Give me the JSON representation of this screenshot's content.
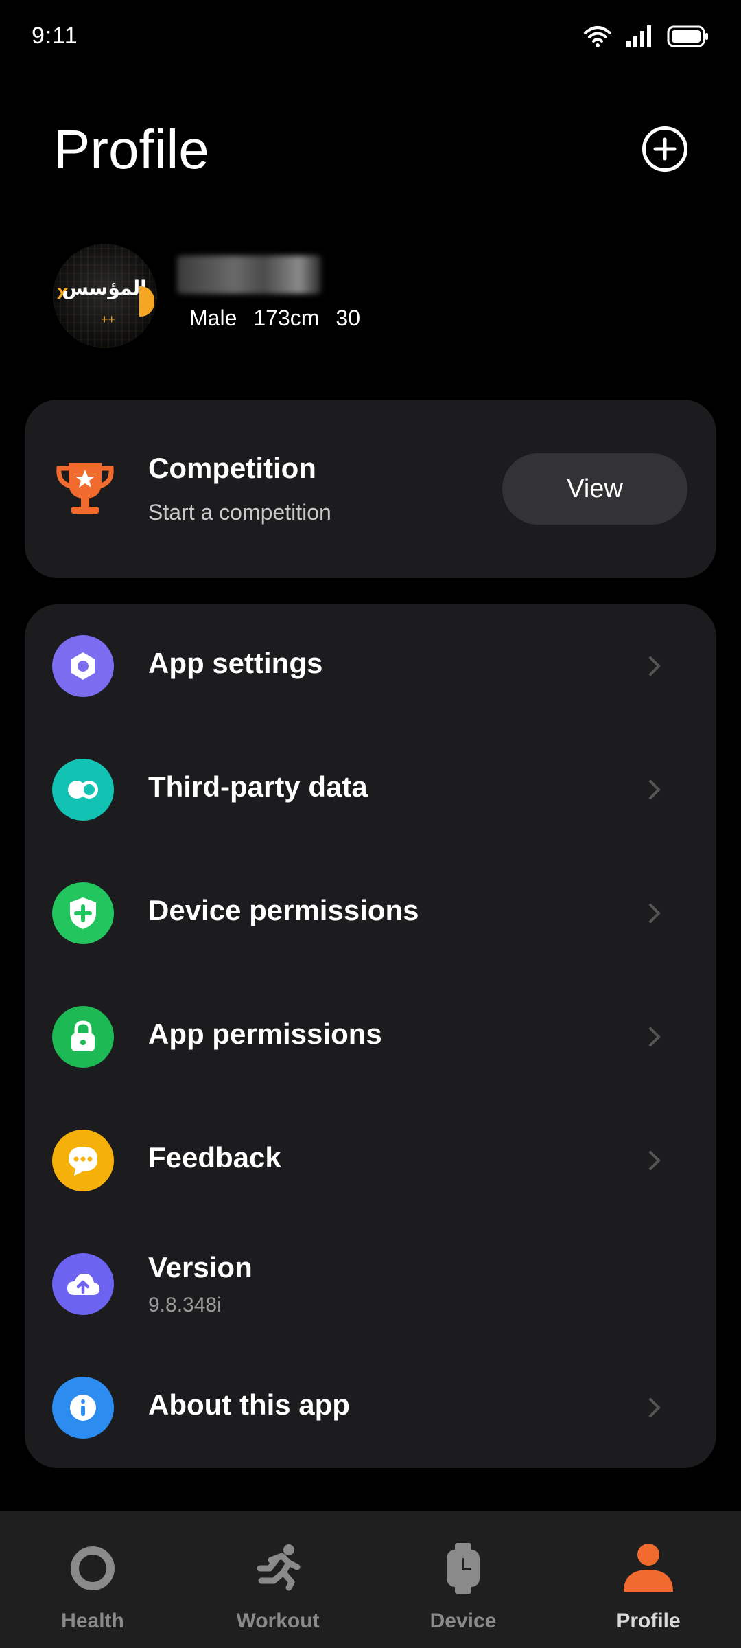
{
  "status_bar": {
    "time": "9:11"
  },
  "header": {
    "title": "Profile"
  },
  "user": {
    "avatar_text": "المؤسس",
    "gender": "Male",
    "height": "173cm",
    "age": "30"
  },
  "competition": {
    "title": "Competition",
    "subtitle": "Start a competition",
    "button_label": "View",
    "icon": "trophy-icon",
    "color": "#F26B2E"
  },
  "settings": {
    "items": [
      {
        "label": "App settings",
        "icon": "gear-icon",
        "color": "#7C6CF0"
      },
      {
        "label": "Third-party data",
        "icon": "link-icon",
        "color": "#12C2B2"
      },
      {
        "label": "Device permissions",
        "icon": "shield-icon",
        "color": "#22C55E"
      },
      {
        "label": "App permissions",
        "icon": "lock-icon",
        "color": "#1DB954"
      },
      {
        "label": "Feedback",
        "icon": "chat-icon",
        "color": "#F5B00A"
      },
      {
        "label": "Version",
        "sublabel": "9.8.348i",
        "icon": "cloud-upload-icon",
        "color": "#6C63F0"
      },
      {
        "label": "About this app",
        "icon": "info-icon",
        "color": "#2D8CF0"
      }
    ]
  },
  "bottom_nav": {
    "items": [
      {
        "label": "Health",
        "icon": "ring-icon"
      },
      {
        "label": "Workout",
        "icon": "running-icon"
      },
      {
        "label": "Device",
        "icon": "watch-icon"
      },
      {
        "label": "Profile",
        "icon": "person-icon",
        "active": true,
        "color": "#F26B2E"
      }
    ]
  }
}
